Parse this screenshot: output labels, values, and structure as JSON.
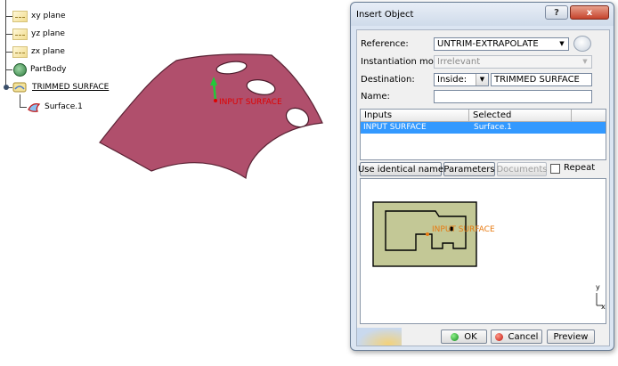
{
  "tree": {
    "items": [
      {
        "label": "xy plane",
        "icon": "plane-icon"
      },
      {
        "label": "yz plane",
        "icon": "plane-icon"
      },
      {
        "label": "zx plane",
        "icon": "plane-icon"
      },
      {
        "label": "PartBody",
        "icon": "partbody-icon"
      },
      {
        "label": "TRIMMED SURFACE",
        "icon": "trimmed-surface-icon"
      },
      {
        "label": "Surface.1",
        "icon": "surface-icon"
      }
    ]
  },
  "viewport": {
    "surface_label": "INPUT SURFACE",
    "surface_color": "#b04f6c",
    "label_color": "#e00000",
    "axis_color": "#22c93a"
  },
  "dialog": {
    "title": "Insert Object",
    "help_button": "?",
    "close_button": "x",
    "reference_label": "Reference:",
    "reference_value": "UNTRIM-EXTRAPOLATE",
    "instantiation_label": "Instantiation mode:",
    "instantiation_value": "Irrelevant",
    "destination_label": "Destination:",
    "destination_mode": "Inside:",
    "destination_value": "TRIMMED SURFACE",
    "name_label": "Name:",
    "name_value": "",
    "inputs_header": "Inputs",
    "selected_header": "Selected",
    "rows": [
      {
        "input": "INPUT SURFACE",
        "selected": "Surface.1"
      }
    ],
    "use_identical_name": "Use identical name",
    "parameters": "Parameters",
    "documents": "Documents",
    "repeat": "Repeat",
    "preview_label": "INPUT SURFACE",
    "preview_fill": "#c3c896",
    "preview_label_color": "#e87a10",
    "axis_y": "y",
    "axis_x": "x",
    "ok": "OK",
    "cancel": "Cancel",
    "preview_button": "Preview"
  }
}
